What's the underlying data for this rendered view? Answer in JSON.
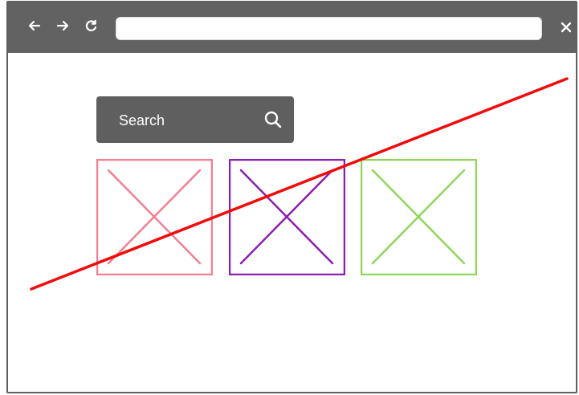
{
  "browser": {
    "address_value": "",
    "search_label": "Search"
  },
  "icons": {
    "back": "arrow-left-icon",
    "forward": "arrow-right-icon",
    "reload": "reload-icon",
    "close": "close-icon",
    "search": "search-icon",
    "image": "image-placeholder-icon"
  },
  "colors": {
    "chrome": "#626262",
    "search_bg": "#5f5f5f",
    "placeholder_pink": "#f08092",
    "placeholder_purple": "#8b1fae",
    "placeholder_green": "#8fd65b",
    "strike_red": "#f20b0b"
  },
  "placeholders": [
    {
      "name": "pink",
      "color": "#f08092"
    },
    {
      "name": "purple",
      "color": "#8b1fae"
    },
    {
      "name": "green",
      "color": "#8fd65b"
    }
  ]
}
